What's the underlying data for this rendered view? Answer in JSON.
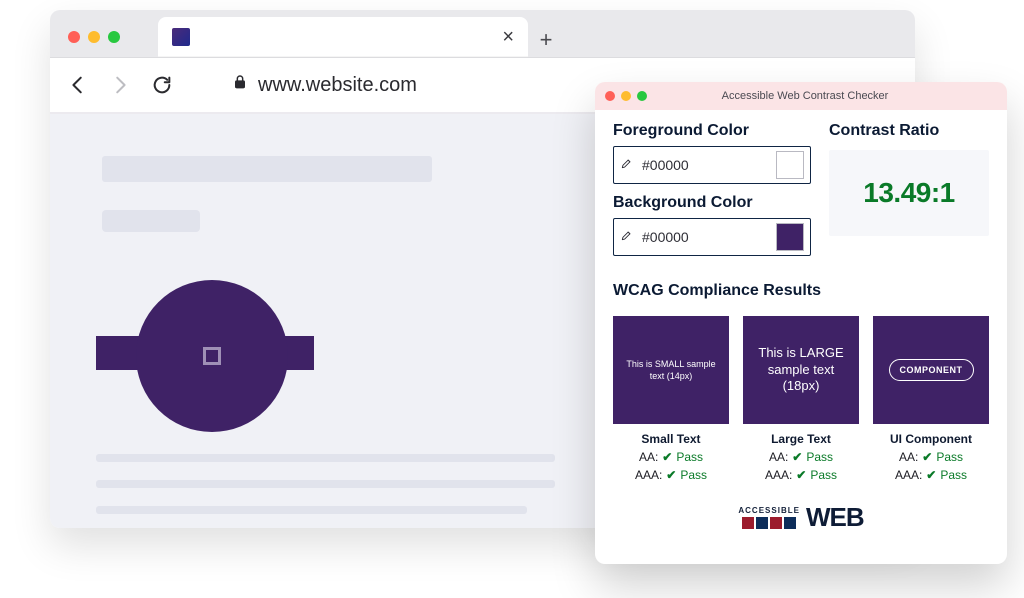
{
  "browser": {
    "url": "www.website.com",
    "close_glyph": "×",
    "newtab_glyph": "+"
  },
  "checker": {
    "window_title": "Accessible Web Contrast Checker",
    "foreground_label": "Foreground Color",
    "background_label": "Background Color",
    "fg_value": "#00000",
    "bg_value": "#00000",
    "ratio_label": "Contrast Ratio",
    "ratio_value": "13.49:1",
    "section_heading": "WCAG Compliance Results",
    "samples": {
      "small": {
        "box_text": "This is SMALL sample text (14px)",
        "label": "Small Text",
        "aa_level": "AA:",
        "aa_status": "Pass",
        "aaa_level": "AAA:",
        "aaa_status": "Pass"
      },
      "large": {
        "box_text": "This is LARGE sample text (18px)",
        "label": "Large Text",
        "aa_level": "AA:",
        "aa_status": "Pass",
        "aaa_level": "AAA:",
        "aaa_status": "Pass"
      },
      "component": {
        "box_text": "COMPONENT",
        "label": "UI Component",
        "aa_level": "AA:",
        "aa_status": "Pass",
        "aaa_level": "AAA:",
        "aaa_status": "Pass"
      }
    },
    "footer": {
      "accessible": "ACCESSIBLE",
      "web": "WEB"
    },
    "check_glyph": "✔"
  },
  "colors": {
    "purple": "#3f2266",
    "pass_green": "#0a7a28"
  }
}
